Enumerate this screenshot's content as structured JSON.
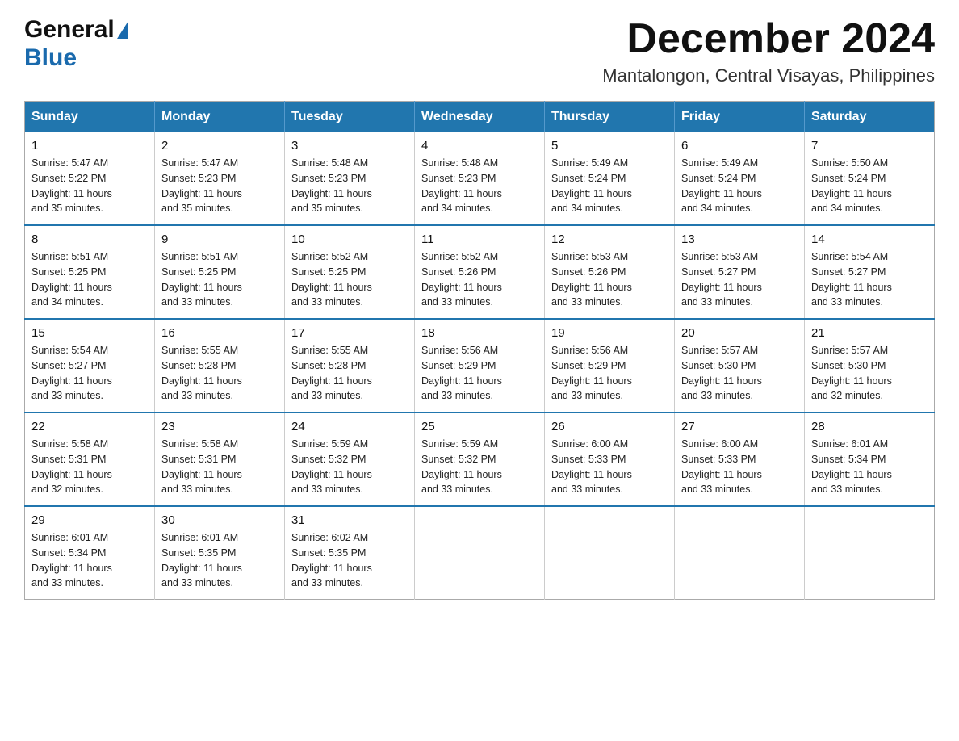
{
  "logo": {
    "general": "General",
    "blue": "Blue"
  },
  "title": {
    "month_year": "December 2024",
    "location": "Mantalongon, Central Visayas, Philippines"
  },
  "weekdays": [
    "Sunday",
    "Monday",
    "Tuesday",
    "Wednesday",
    "Thursday",
    "Friday",
    "Saturday"
  ],
  "weeks": [
    [
      {
        "day": "1",
        "sunrise": "5:47 AM",
        "sunset": "5:22 PM",
        "daylight": "11 hours and 35 minutes."
      },
      {
        "day": "2",
        "sunrise": "5:47 AM",
        "sunset": "5:23 PM",
        "daylight": "11 hours and 35 minutes."
      },
      {
        "day": "3",
        "sunrise": "5:48 AM",
        "sunset": "5:23 PM",
        "daylight": "11 hours and 35 minutes."
      },
      {
        "day": "4",
        "sunrise": "5:48 AM",
        "sunset": "5:23 PM",
        "daylight": "11 hours and 34 minutes."
      },
      {
        "day": "5",
        "sunrise": "5:49 AM",
        "sunset": "5:24 PM",
        "daylight": "11 hours and 34 minutes."
      },
      {
        "day": "6",
        "sunrise": "5:49 AM",
        "sunset": "5:24 PM",
        "daylight": "11 hours and 34 minutes."
      },
      {
        "day": "7",
        "sunrise": "5:50 AM",
        "sunset": "5:24 PM",
        "daylight": "11 hours and 34 minutes."
      }
    ],
    [
      {
        "day": "8",
        "sunrise": "5:51 AM",
        "sunset": "5:25 PM",
        "daylight": "11 hours and 34 minutes."
      },
      {
        "day": "9",
        "sunrise": "5:51 AM",
        "sunset": "5:25 PM",
        "daylight": "11 hours and 33 minutes."
      },
      {
        "day": "10",
        "sunrise": "5:52 AM",
        "sunset": "5:25 PM",
        "daylight": "11 hours and 33 minutes."
      },
      {
        "day": "11",
        "sunrise": "5:52 AM",
        "sunset": "5:26 PM",
        "daylight": "11 hours and 33 minutes."
      },
      {
        "day": "12",
        "sunrise": "5:53 AM",
        "sunset": "5:26 PM",
        "daylight": "11 hours and 33 minutes."
      },
      {
        "day": "13",
        "sunrise": "5:53 AM",
        "sunset": "5:27 PM",
        "daylight": "11 hours and 33 minutes."
      },
      {
        "day": "14",
        "sunrise": "5:54 AM",
        "sunset": "5:27 PM",
        "daylight": "11 hours and 33 minutes."
      }
    ],
    [
      {
        "day": "15",
        "sunrise": "5:54 AM",
        "sunset": "5:27 PM",
        "daylight": "11 hours and 33 minutes."
      },
      {
        "day": "16",
        "sunrise": "5:55 AM",
        "sunset": "5:28 PM",
        "daylight": "11 hours and 33 minutes."
      },
      {
        "day": "17",
        "sunrise": "5:55 AM",
        "sunset": "5:28 PM",
        "daylight": "11 hours and 33 minutes."
      },
      {
        "day": "18",
        "sunrise": "5:56 AM",
        "sunset": "5:29 PM",
        "daylight": "11 hours and 33 minutes."
      },
      {
        "day": "19",
        "sunrise": "5:56 AM",
        "sunset": "5:29 PM",
        "daylight": "11 hours and 33 minutes."
      },
      {
        "day": "20",
        "sunrise": "5:57 AM",
        "sunset": "5:30 PM",
        "daylight": "11 hours and 33 minutes."
      },
      {
        "day": "21",
        "sunrise": "5:57 AM",
        "sunset": "5:30 PM",
        "daylight": "11 hours and 32 minutes."
      }
    ],
    [
      {
        "day": "22",
        "sunrise": "5:58 AM",
        "sunset": "5:31 PM",
        "daylight": "11 hours and 32 minutes."
      },
      {
        "day": "23",
        "sunrise": "5:58 AM",
        "sunset": "5:31 PM",
        "daylight": "11 hours and 33 minutes."
      },
      {
        "day": "24",
        "sunrise": "5:59 AM",
        "sunset": "5:32 PM",
        "daylight": "11 hours and 33 minutes."
      },
      {
        "day": "25",
        "sunrise": "5:59 AM",
        "sunset": "5:32 PM",
        "daylight": "11 hours and 33 minutes."
      },
      {
        "day": "26",
        "sunrise": "6:00 AM",
        "sunset": "5:33 PM",
        "daylight": "11 hours and 33 minutes."
      },
      {
        "day": "27",
        "sunrise": "6:00 AM",
        "sunset": "5:33 PM",
        "daylight": "11 hours and 33 minutes."
      },
      {
        "day": "28",
        "sunrise": "6:01 AM",
        "sunset": "5:34 PM",
        "daylight": "11 hours and 33 minutes."
      }
    ],
    [
      {
        "day": "29",
        "sunrise": "6:01 AM",
        "sunset": "5:34 PM",
        "daylight": "11 hours and 33 minutes."
      },
      {
        "day": "30",
        "sunrise": "6:01 AM",
        "sunset": "5:35 PM",
        "daylight": "11 hours and 33 minutes."
      },
      {
        "day": "31",
        "sunrise": "6:02 AM",
        "sunset": "5:35 PM",
        "daylight": "11 hours and 33 minutes."
      },
      null,
      null,
      null,
      null
    ]
  ],
  "labels": {
    "sunrise": "Sunrise:",
    "sunset": "Sunset:",
    "daylight": "Daylight:"
  }
}
